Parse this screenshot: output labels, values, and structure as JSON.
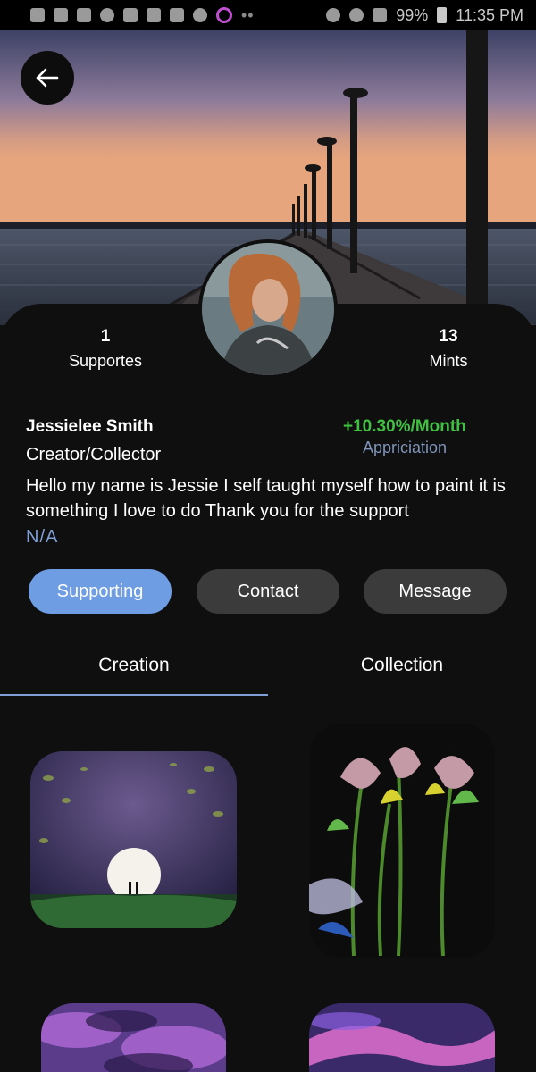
{
  "status_bar": {
    "battery": "99%",
    "time": "11:35 PM"
  },
  "profile": {
    "supporters_count": "1",
    "supporters_label": "Supportes",
    "mints_count": "13",
    "mints_label": "Mints",
    "name": "Jessielee Smith",
    "role": "Creator/Collector",
    "appreciation_rate": "+10.30%/Month",
    "appreciation_label": "Appriciation",
    "bio": "Hello my name is Jessie I self taught myself how to paint it is something I love to do Thank you for the support",
    "link": "N/A"
  },
  "actions": {
    "supporting": "Supporting",
    "contact": "Contact",
    "message": "Message"
  },
  "tabs": {
    "creation": "Creation",
    "collection": "Collection"
  },
  "colors": {
    "accent": "#6e9de4",
    "positive": "#3fc040",
    "muted_link": "#7f9fd6",
    "background": "#0f0f0f"
  }
}
